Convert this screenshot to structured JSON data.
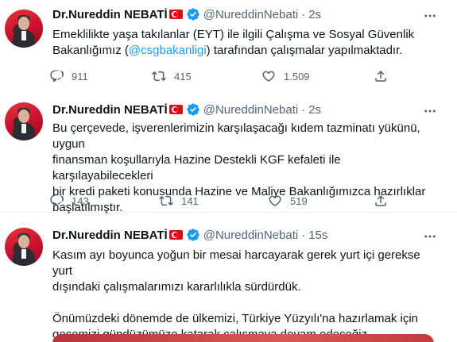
{
  "tweets": [
    {
      "name": "Dr.Nureddin NEBATİ",
      "handle": "@NureddinNebati",
      "separator": "·",
      "time": "2s",
      "text_before": "Emeklilikte yaşa takılanlar (EYT) ile ilgili Çalışma ve Sosyal Güvenlik\nBakanlığımız (",
      "mention": "@csgbakanligi",
      "text_after": ") tarafından çalışmalar yapılmaktadır.",
      "replies": "911",
      "retweets": "415",
      "likes": "1.509"
    },
    {
      "name": "Dr.Nureddin NEBATİ",
      "handle": "@NureddinNebati",
      "separator": "·",
      "time": "2s",
      "text": "Bu çerçevede, işverenlerimizin karşılaşacağı kıdem tazminatı yükünü, uygun\nfinansman koşullarıyla Hazine Destekli KGF kefaleti ile karşılayabilecekleri\nbir kredi paketi konusunda Hazine ve Maliye Bakanlığımızca hazırlıklar\nbaşlatılmıştır.",
      "replies": "143",
      "retweets": "141",
      "likes": "519"
    },
    {
      "name": "Dr.Nureddin NEBATİ",
      "handle": "@NureddinNebati",
      "separator": "·",
      "time": "15s",
      "text": "Kasım ayı boyunca yoğun bir mesai harcayarak gerek yurt içi gerekse yurt\ndışındaki çalışmalarımızı kararlılıkla sürdürdük.\n\nÖnümüzdeki dönemde de ülkemizi, Türkiye Yüzyılı'na hazırlamak için\ngecemizi gündüzümüze katarak çalışmaya devam edeceğiz."
    }
  ],
  "colors": {
    "accent": "#1d9bf0",
    "secondary_text": "#536471",
    "primary_text": "#0f1419",
    "flag_red": "#e30a17"
  },
  "icons": [
    "verified-badge-icon",
    "turkish-flag-icon",
    "more-options-icon",
    "reply-icon",
    "retweet-icon",
    "like-icon",
    "share-icon"
  ]
}
